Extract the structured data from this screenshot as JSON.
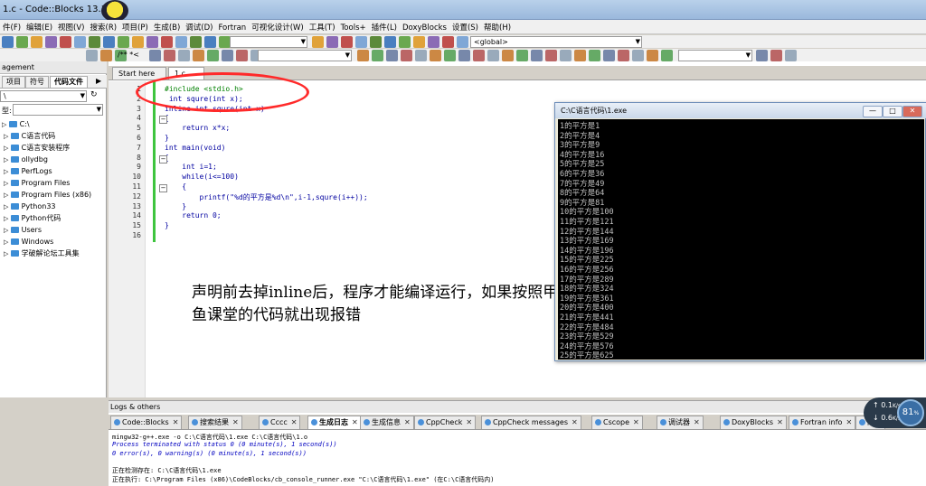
{
  "window": {
    "title": "1.c - Code::Blocks 13.12"
  },
  "menu": [
    "件(F)",
    "编辑(E)",
    "视图(V)",
    "搜索(R)",
    "项目(P)",
    "生成(B)",
    "调试(D)",
    "Fortran",
    "可视化设计(W)",
    "工具(T)",
    "Tools+",
    "插件(L)",
    "DoxyBlocks",
    "设置(S)",
    "帮助(H)"
  ],
  "toolbar": {
    "scope_combo": "<global>",
    "comment_btn": "/** *<"
  },
  "left_panel": {
    "title": "agement",
    "tabs": [
      "项目",
      "符号",
      "代码文件"
    ],
    "path_combo": "\\",
    "filter_label": "型:",
    "tree": [
      "C:\\",
      "C语言代码",
      "C语言安装程序",
      "ollydbg",
      "PerfLogs",
      "Program Files",
      "Program Files (x86)",
      "Python33",
      "Python代码",
      "Users",
      "Windows",
      "学破解论坛工具集"
    ]
  },
  "editor": {
    "tabs": [
      "Start here",
      "1.c"
    ],
    "line_numbers": [
      "1",
      "2",
      "3",
      "4",
      "5",
      "6",
      "7",
      "8",
      "9",
      "10",
      "11",
      "12",
      "13",
      "14",
      "15",
      "16"
    ],
    "lines": [
      "#include <stdio.h>",
      " int squre(int x);",
      "inline int squre(int x)",
      "{",
      "    return x*x;",
      "}",
      "int main(void)",
      "{",
      "    int i=1;",
      "    while(i<=100)",
      "    {",
      "        printf(\"%d的平方是%d\\n\",i-1,squre(i++));",
      "    }",
      "    return 0;",
      "}",
      ""
    ],
    "annotation": "声明前去掉inline后，程序才能编译运行，如果按照甲鱼课堂的代码就出现报错"
  },
  "console": {
    "title": "C:\\C语言代码\\1.exe",
    "buttons": [
      "—",
      "□",
      "✕"
    ],
    "lines": [
      "1的平方是1",
      "2的平方是4",
      "3的平方是9",
      "4的平方是16",
      "5的平方是25",
      "6的平方是36",
      "7的平方是49",
      "8的平方是64",
      "9的平方是81",
      "10的平方是100",
      "11的平方是121",
      "12的平方是144",
      "13的平方是169",
      "14的平方是196",
      "15的平方是225",
      "16的平方是256",
      "17的平方是289",
      "18的平方是324",
      "19的平方是361",
      "20的平方是400",
      "21的平方是441",
      "22的平方是484",
      "23的平方是529",
      "24的平方是576",
      "25的平方是625"
    ]
  },
  "logs": {
    "title": "Logs & others",
    "tabs": [
      "Code::Blocks",
      "搜索结果",
      "Cccc",
      "生成日志",
      "生成信息",
      "CppCheck",
      "CppCheck messages",
      "Cscope",
      "调试器",
      "DoxyBlocks",
      "Fortran info",
      "闭关"
    ],
    "lines": [
      "mingw32-g++.exe  -o C:\\C语言代码\\1.exe C:\\C语言代码\\1.o",
      "Process terminated with status 0 (0 minute(s), 1 second(s))",
      "0 error(s), 0 warning(s) (0 minute(s), 1 second(s))",
      "",
      "正在检测存在: C:\\C语言代码\\1.exe",
      "正在执行: C:\\Program Files (x86)\\CodeBlocks/cb_console_runner.exe \"C:\\C语言代码\\1.exe\" (在C:\\C语言代码内)"
    ]
  },
  "net_meter": {
    "up": "0.1",
    "down": "0.6",
    "unit": "K/s",
    "percent": "81"
  }
}
